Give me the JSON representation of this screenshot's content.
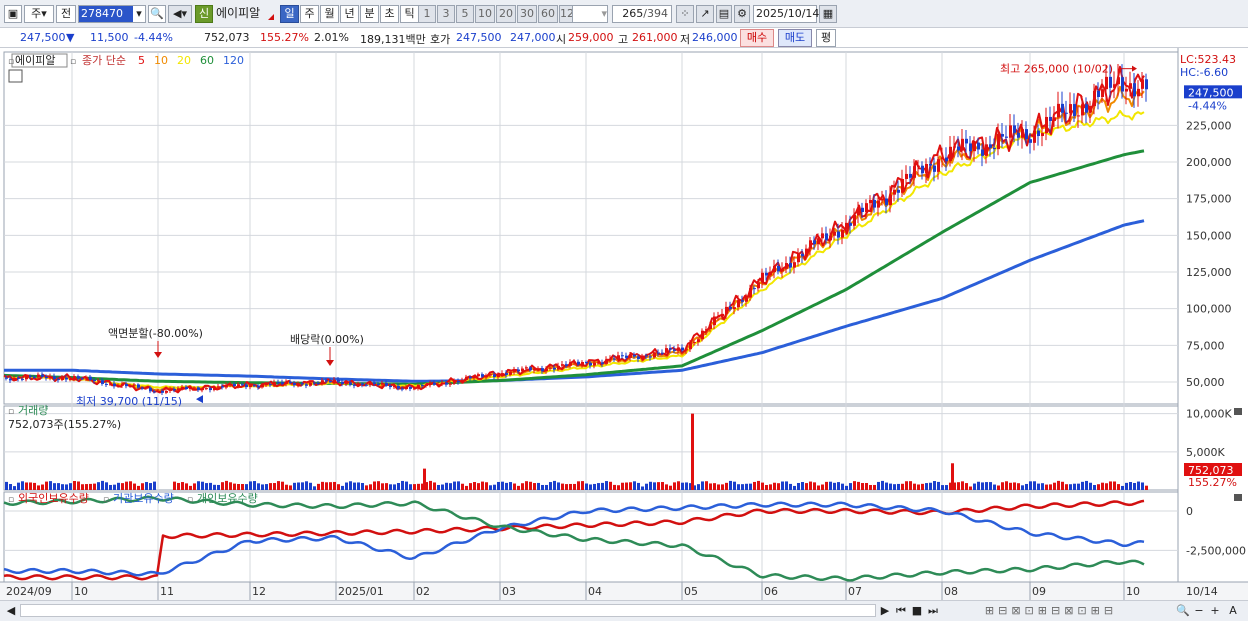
{
  "toolbar": {
    "window_icon": "window-icon",
    "market_select": "주",
    "prev_label": "전",
    "code_value": "278470",
    "new_badge": "신",
    "stock_name": "에이피알",
    "period_tabs": [
      "일",
      "주",
      "월",
      "년",
      "분",
      "초",
      "틱"
    ],
    "active_period": "일",
    "interval_buttons": [
      "1",
      "3",
      "5",
      "10",
      "20",
      "30",
      "60",
      "120"
    ],
    "count_value": "265",
    "count_total": "/394",
    "date_value": "2025/10/14"
  },
  "quote": {
    "price": "247,500",
    "change_arrow": "▼",
    "change": "11,500",
    "change_rate": "-4.44%",
    "volume": "752,073",
    "volume_ratio": "155.27%",
    "turnover_rate": "2.01%",
    "trade_value": "189,131백만",
    "ask_label": "호가",
    "ask_price": "247,500",
    "bid_price": "247,000",
    "open_label": "시",
    "open_price": "259,000",
    "high_label": "고",
    "high_price": "261,000",
    "low_label": "저",
    "low_price": "246,000",
    "buy_button": "매수",
    "sell_button": "매도",
    "eval_button": "평"
  },
  "price_panel": {
    "stock_name": "에이피알",
    "indicator_title": "종가 단순",
    "ma_periods": [
      "5",
      "10",
      "20",
      "60",
      "120"
    ],
    "ma_colors": [
      "#e01010",
      "#f08a00",
      "#f2e600",
      "#1f8f3a",
      "#2b5fd9"
    ],
    "lc_label": "LC:523.43",
    "hc_label": "HC:-6.60",
    "current_price_tag": "247,500",
    "current_change_tag": "-4.44%",
    "high_annotation": "최고 265,000 (10/02)",
    "low_annotation": "최저 39,700 (11/15)",
    "split_annotation": "액면분할(-80.00%)",
    "dividend_annotation": "배당락(0.00%)"
  },
  "volume_panel": {
    "title": "거래량",
    "info": "752,073주(155.27%)",
    "current_tag": "752,073",
    "ratio_tag": "155.27%"
  },
  "holding_panel": {
    "titles": [
      "외국인보유수량",
      "기관보유수량",
      "개인보유수량"
    ],
    "colors": [
      "#d21010",
      "#2b5fd9",
      "#2e8b57"
    ]
  },
  "x_axis_labels": [
    "2024/09",
    "10",
    "11",
    "12",
    "2025/01",
    "02",
    "03",
    "04",
    "05",
    "06",
    "07",
    "08",
    "09",
    "10",
    "10/14"
  ],
  "chart_data": [
    {
      "type": "line",
      "title": "에이피알",
      "x": [
        "2024/09",
        "2024/10",
        "2024/11",
        "2024/12",
        "2025/01",
        "2025/02",
        "2025/03",
        "2025/04",
        "2025/05",
        "2025/06",
        "2025/07",
        "2025/08",
        "2025/09",
        "2025/10",
        "2025/10/14"
      ],
      "series": [
        {
          "name": "5",
          "values": [
            53000,
            53000,
            44000,
            48000,
            50000,
            46000,
            56000,
            63000,
            72000,
            120000,
            158000,
            205000,
            220000,
            255000,
            247500
          ]
        },
        {
          "name": "10",
          "values": [
            53000,
            52500,
            45000,
            47500,
            49500,
            46500,
            55000,
            62000,
            70000,
            118000,
            155000,
            200000,
            220000,
            245000,
            242000
          ]
        },
        {
          "name": "20",
          "values": [
            53500,
            52000,
            46500,
            47000,
            49000,
            47500,
            53500,
            60000,
            68000,
            113000,
            150000,
            192000,
            218000,
            232000,
            232000
          ]
        },
        {
          "name": "60",
          "values": [
            54500,
            53000,
            50500,
            49500,
            49000,
            48500,
            51000,
            55000,
            61000,
            85000,
            113000,
            152000,
            186000,
            205000,
            212000
          ]
        },
        {
          "name": "120",
          "values": [
            58000,
            58000,
            55500,
            54000,
            52000,
            50500,
            51000,
            53500,
            58000,
            70000,
            88000,
            107000,
            133000,
            157000,
            165000
          ]
        }
      ],
      "y_ticks": [
        "50,000",
        "75,000",
        "100,000",
        "125,000",
        "150,000",
        "175,000",
        "200,000",
        "225,000"
      ],
      "ylim": [
        35000,
        275000
      ],
      "high": {
        "value": 265000,
        "date": "10/02"
      },
      "low": {
        "value": 39700,
        "date": "11/15"
      },
      "current": 247500
    },
    {
      "type": "bar",
      "title": "거래량",
      "y_ticks": [
        "5,000K",
        "10,000K"
      ],
      "ylim": [
        0,
        11000000
      ],
      "spikes": [
        {
          "month": "2025/02",
          "value": 2800000
        },
        {
          "month": "2025/05",
          "value": 10000000
        },
        {
          "month": "2025/08",
          "value": 3500000
        },
        {
          "month": "2025/10",
          "value": 752073
        }
      ]
    },
    {
      "type": "line",
      "title": "보유수량",
      "x": [
        "2024/09",
        "2024/10",
        "2024/11",
        "2024/12",
        "2025/01",
        "2025/02",
        "2025/03",
        "2025/04",
        "2025/05",
        "2025/06",
        "2025/07",
        "2025/08",
        "2025/09",
        "2025/10",
        "2025/10/14"
      ],
      "series": [
        {
          "name": "외국인보유수량",
          "values": [
            -4200000,
            -4200000,
            -1600000,
            -1500000,
            -1400000,
            -1300000,
            -1100000,
            -900000,
            -700000,
            0,
            0,
            -100000,
            300000,
            500000,
            550000
          ]
        },
        {
          "name": "기관보유수량",
          "values": [
            -3800000,
            -3800000,
            -4000000,
            -1900000,
            -1700000,
            -3000000,
            -1100000,
            0,
            200000,
            400000,
            400000,
            0,
            -1400000,
            -2100000,
            -1900000
          ]
        },
        {
          "name": "개인보유수량",
          "values": [
            500000,
            600000,
            800000,
            400000,
            300000,
            500000,
            -1000000,
            -1800000,
            -2200000,
            -4100000,
            -4300000,
            -3900000,
            -3700000,
            -3200000,
            -3600000
          ]
        }
      ],
      "y_ticks": [
        "0",
        "-2,500,000"
      ],
      "ylim": [
        -4500000,
        1200000
      ]
    }
  ],
  "scrollbar": {
    "left_arrow": "◀",
    "right_arrow": "▶",
    "zoom_out": "−",
    "zoom_in": "+",
    "font_btn": "A"
  }
}
